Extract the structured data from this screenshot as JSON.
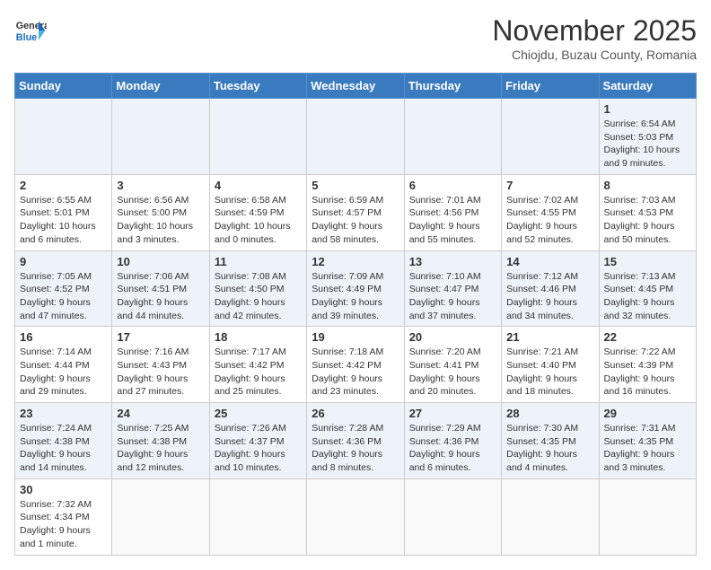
{
  "header": {
    "logo_general": "General",
    "logo_blue": "Blue",
    "month_title": "November 2025",
    "subtitle": "Chiojdu, Buzau County, Romania"
  },
  "weekdays": [
    "Sunday",
    "Monday",
    "Tuesday",
    "Wednesday",
    "Thursday",
    "Friday",
    "Saturday"
  ],
  "weeks": [
    [
      {
        "day": "",
        "info": ""
      },
      {
        "day": "",
        "info": ""
      },
      {
        "day": "",
        "info": ""
      },
      {
        "day": "",
        "info": ""
      },
      {
        "day": "",
        "info": ""
      },
      {
        "day": "",
        "info": ""
      },
      {
        "day": "1",
        "info": "Sunrise: 6:54 AM\nSunset: 5:03 PM\nDaylight: 10 hours and 9 minutes."
      }
    ],
    [
      {
        "day": "2",
        "info": "Sunrise: 6:55 AM\nSunset: 5:01 PM\nDaylight: 10 hours and 6 minutes."
      },
      {
        "day": "3",
        "info": "Sunrise: 6:56 AM\nSunset: 5:00 PM\nDaylight: 10 hours and 3 minutes."
      },
      {
        "day": "4",
        "info": "Sunrise: 6:58 AM\nSunset: 4:59 PM\nDaylight: 10 hours and 0 minutes."
      },
      {
        "day": "5",
        "info": "Sunrise: 6:59 AM\nSunset: 4:57 PM\nDaylight: 9 hours and 58 minutes."
      },
      {
        "day": "6",
        "info": "Sunrise: 7:01 AM\nSunset: 4:56 PM\nDaylight: 9 hours and 55 minutes."
      },
      {
        "day": "7",
        "info": "Sunrise: 7:02 AM\nSunset: 4:55 PM\nDaylight: 9 hours and 52 minutes."
      },
      {
        "day": "8",
        "info": "Sunrise: 7:03 AM\nSunset: 4:53 PM\nDaylight: 9 hours and 50 minutes."
      }
    ],
    [
      {
        "day": "9",
        "info": "Sunrise: 7:05 AM\nSunset: 4:52 PM\nDaylight: 9 hours and 47 minutes."
      },
      {
        "day": "10",
        "info": "Sunrise: 7:06 AM\nSunset: 4:51 PM\nDaylight: 9 hours and 44 minutes."
      },
      {
        "day": "11",
        "info": "Sunrise: 7:08 AM\nSunset: 4:50 PM\nDaylight: 9 hours and 42 minutes."
      },
      {
        "day": "12",
        "info": "Sunrise: 7:09 AM\nSunset: 4:49 PM\nDaylight: 9 hours and 39 minutes."
      },
      {
        "day": "13",
        "info": "Sunrise: 7:10 AM\nSunset: 4:47 PM\nDaylight: 9 hours and 37 minutes."
      },
      {
        "day": "14",
        "info": "Sunrise: 7:12 AM\nSunset: 4:46 PM\nDaylight: 9 hours and 34 minutes."
      },
      {
        "day": "15",
        "info": "Sunrise: 7:13 AM\nSunset: 4:45 PM\nDaylight: 9 hours and 32 minutes."
      }
    ],
    [
      {
        "day": "16",
        "info": "Sunrise: 7:14 AM\nSunset: 4:44 PM\nDaylight: 9 hours and 29 minutes."
      },
      {
        "day": "17",
        "info": "Sunrise: 7:16 AM\nSunset: 4:43 PM\nDaylight: 9 hours and 27 minutes."
      },
      {
        "day": "18",
        "info": "Sunrise: 7:17 AM\nSunset: 4:42 PM\nDaylight: 9 hours and 25 minutes."
      },
      {
        "day": "19",
        "info": "Sunrise: 7:18 AM\nSunset: 4:42 PM\nDaylight: 9 hours and 23 minutes."
      },
      {
        "day": "20",
        "info": "Sunrise: 7:20 AM\nSunset: 4:41 PM\nDaylight: 9 hours and 20 minutes."
      },
      {
        "day": "21",
        "info": "Sunrise: 7:21 AM\nSunset: 4:40 PM\nDaylight: 9 hours and 18 minutes."
      },
      {
        "day": "22",
        "info": "Sunrise: 7:22 AM\nSunset: 4:39 PM\nDaylight: 9 hours and 16 minutes."
      }
    ],
    [
      {
        "day": "23",
        "info": "Sunrise: 7:24 AM\nSunset: 4:38 PM\nDaylight: 9 hours and 14 minutes."
      },
      {
        "day": "24",
        "info": "Sunrise: 7:25 AM\nSunset: 4:38 PM\nDaylight: 9 hours and 12 minutes."
      },
      {
        "day": "25",
        "info": "Sunrise: 7:26 AM\nSunset: 4:37 PM\nDaylight: 9 hours and 10 minutes."
      },
      {
        "day": "26",
        "info": "Sunrise: 7:28 AM\nSunset: 4:36 PM\nDaylight: 9 hours and 8 minutes."
      },
      {
        "day": "27",
        "info": "Sunrise: 7:29 AM\nSunset: 4:36 PM\nDaylight: 9 hours and 6 minutes."
      },
      {
        "day": "28",
        "info": "Sunrise: 7:30 AM\nSunset: 4:35 PM\nDaylight: 9 hours and 4 minutes."
      },
      {
        "day": "29",
        "info": "Sunrise: 7:31 AM\nSunset: 4:35 PM\nDaylight: 9 hours and 3 minutes."
      }
    ],
    [
      {
        "day": "30",
        "info": "Sunrise: 7:32 AM\nSunset: 4:34 PM\nDaylight: 9 hours and 1 minute."
      },
      {
        "day": "",
        "info": ""
      },
      {
        "day": "",
        "info": ""
      },
      {
        "day": "",
        "info": ""
      },
      {
        "day": "",
        "info": ""
      },
      {
        "day": "",
        "info": ""
      },
      {
        "day": "",
        "info": ""
      }
    ]
  ]
}
